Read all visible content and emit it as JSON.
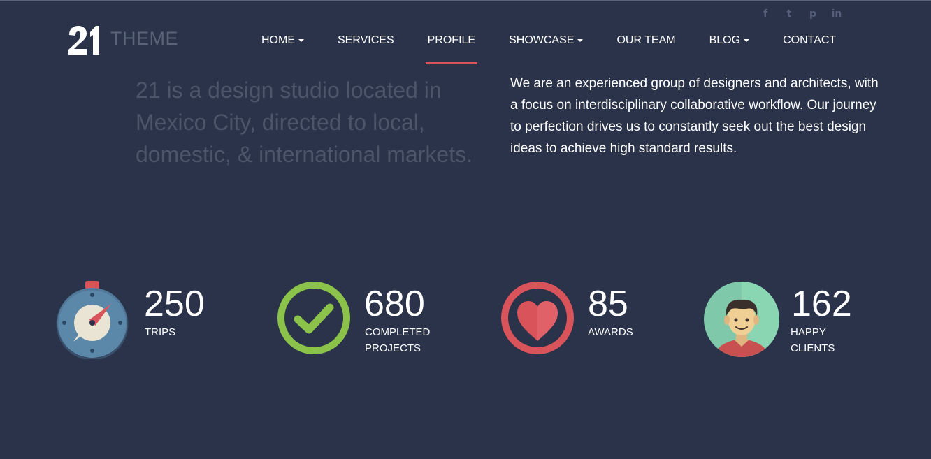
{
  "header": {
    "logo_word": "THEME",
    "social": [
      {
        "icon": "facebook-icon",
        "glyph": "f"
      },
      {
        "icon": "twitter-icon",
        "glyph": "t"
      },
      {
        "icon": "pinterest-icon",
        "glyph": "p"
      },
      {
        "icon": "linkedin-icon",
        "glyph": "in"
      }
    ],
    "nav": [
      {
        "label": "HOME",
        "dropdown": true,
        "active": false
      },
      {
        "label": "SERVICES",
        "dropdown": false,
        "active": false
      },
      {
        "label": "PROFILE",
        "dropdown": false,
        "active": true
      },
      {
        "label": "SHOWCASE",
        "dropdown": true,
        "active": false
      },
      {
        "label": "OUR TEAM",
        "dropdown": false,
        "active": false
      },
      {
        "label": "BLOG",
        "dropdown": true,
        "active": false
      },
      {
        "label": "CONTACT",
        "dropdown": false,
        "active": false
      }
    ]
  },
  "intro": {
    "tagline": "21 is a design studio located in Mexico City, directed to local, domestic, & international markets.",
    "description": "We are an experienced group of designers and architects, with a focus on interdisciplinary collaborative workflow. Our journey to perfection drives us to constantly seek out the best design ideas to achieve high standard results."
  },
  "stats": [
    {
      "icon": "compass-icon",
      "number": "250",
      "label_lines": [
        "TRIPS"
      ]
    },
    {
      "icon": "checkmark-circle-icon",
      "number": "680",
      "label_lines": [
        "COMPLETED",
        "PROJECTS"
      ]
    },
    {
      "icon": "heart-icon",
      "number": "85",
      "label_lines": [
        "AWARDS"
      ]
    },
    {
      "icon": "happy-client-avatar-icon",
      "number": "162",
      "label_lines": [
        "HAPPY",
        "CLIENTS"
      ]
    }
  ],
  "colors": {
    "background": "#2a3349",
    "accent": "#d9535a",
    "muted_text": "#4c5569",
    "check_green": "#8bc34a",
    "heart_red": "#d9535a",
    "compass_blue": "#5b87a8"
  }
}
